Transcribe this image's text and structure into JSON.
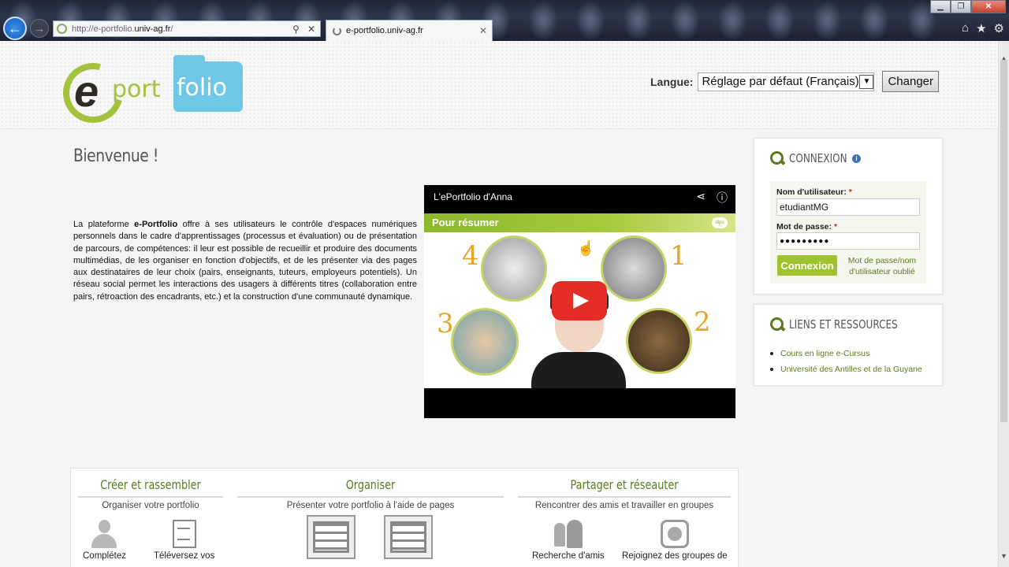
{
  "browser": {
    "url_prefix": "http://e-portfolio.",
    "url_host": "univ-ag.fr",
    "url_suffix": "/",
    "tab_title": "e-portfolio.univ-ag.fr",
    "tab_close": "✕",
    "addr_search": "⚲",
    "addr_stop": "✕"
  },
  "header": {
    "logo_e": "e",
    "logo_port": "port",
    "logo_folio": "folio",
    "language_label": "Langue:",
    "language_value": "Réglage par défaut (Français)",
    "change_button": "Changer"
  },
  "main": {
    "title": "Bienvenue !",
    "intro_prefix": "La plateforme ",
    "intro_brand": "e-Portfolio",
    "intro_rest": " offre à ses utilisateurs le contrôle d'espaces numériques personnels dans le cadre d'apprentissages (processus et évaluation) ou de présentation de parcours, de compétences: il leur est possible de recueillir et produire des documents multimédias, de les organiser en fonction d'objectifs, et de les présenter via des pages aux destinataires de leur choix (pairs, enseignants, tuteurs, employeurs potentiels). Un réseau social permet les interactions des usagers à différents titres (collaboration entre pairs, rétroaction des encadrants, etc.) et la construction d'une communauté dynamique."
  },
  "video": {
    "title": "L'ePortfolio d'Anna",
    "banner": "Pour résumer",
    "badge": "dlpo",
    "numbers": [
      "4",
      "1",
      "3",
      "2"
    ]
  },
  "login": {
    "title": "CONNEXION",
    "username_label": "Nom d'utilisateur:",
    "username_value": "etudiantMG",
    "password_label": "Mot de passe:",
    "password_value": "●●●●●●●●●",
    "required_mark": "*",
    "submit": "Connexion",
    "forgot": "Mot de passe/nom d'utilisateur oublié"
  },
  "links": {
    "title": "LIENS ET RESSOURCES",
    "items": [
      "Cours en ligne e-Cursus",
      "Université des Antilles et de la Guyane"
    ]
  },
  "features": [
    {
      "title": "Créer et rassembler",
      "subtitle": "Organiser votre portfolio",
      "items": [
        "Complétez",
        "Téléversez vos"
      ]
    },
    {
      "title": "Organiser",
      "subtitle": "Présenter votre portfolio à l'aide de pages",
      "items": [
        "",
        ""
      ]
    },
    {
      "title": "Partager et réseauter",
      "subtitle": "Rencontrer des amis et travailler en groupes",
      "items": [
        "Recherche d'amis",
        "Rejoignez des groupes de"
      ]
    }
  ],
  "colors": {
    "accent_green": "#9ec32f",
    "title_green": "#5b7a1e",
    "logo_blue": "#6ec9e6",
    "youtube_red": "#e52d27"
  }
}
